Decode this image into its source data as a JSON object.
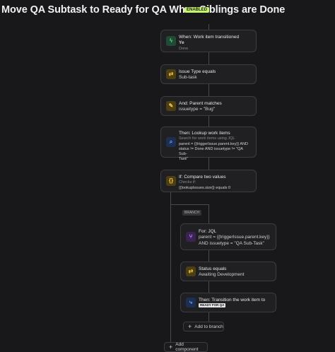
{
  "header": {
    "title": "Move QA Subtask to Ready for QA When Siblings are Done",
    "status_badge": "ENABLED"
  },
  "colors": {
    "enabled_badge": "#c6f36d",
    "trigger_icon": "#5fd38f",
    "condition_icon": "#f2c44a",
    "action_icon": "#6fa0ff",
    "branch_icon": "#c490ff"
  },
  "steps": {
    "trigger": {
      "icon": "lightning-icon",
      "title": "When: Work item transitioned",
      "from": "Ye",
      "to": "Done"
    },
    "issue_type": {
      "icon": "swap-icon",
      "title": "Issue Type equals",
      "value": "Sub-task"
    },
    "parent_matches": {
      "icon": "pencil-icon",
      "title": "And: Parent matches",
      "value": "issuetype = \"Bug\""
    },
    "lookup": {
      "icon": "search-icon",
      "title": "Then: Lookup work items",
      "sub": "Search for work items using JQL",
      "jql1": "parent = {{triggerIssue.parent.key}} AND",
      "jql2": "status != Done AND issuetype != \"QA Sub-",
      "jql3": "Task\""
    },
    "compare": {
      "icon": "braces-icon",
      "title": "If: Compare two values",
      "sub": "Checks if:",
      "value": "{{lookupIssues.size}} equals 0"
    }
  },
  "branch": {
    "label": "BRANCH",
    "for_jql": {
      "icon": "branch-icon",
      "title": "For: JQL",
      "line1": "parent = {{triggerIssue.parent.key}}",
      "line2": "AND issuetype = \"QA Sub-Task\""
    },
    "status": {
      "icon": "swap-icon",
      "title": "Status equals",
      "value": "Awaiting Development"
    },
    "transition": {
      "icon": "transition-icon",
      "title": "Then: Transition the work item to",
      "target": "READY FOR QA"
    },
    "add_to_branch": "Add to branch"
  },
  "add_component": "Add component"
}
